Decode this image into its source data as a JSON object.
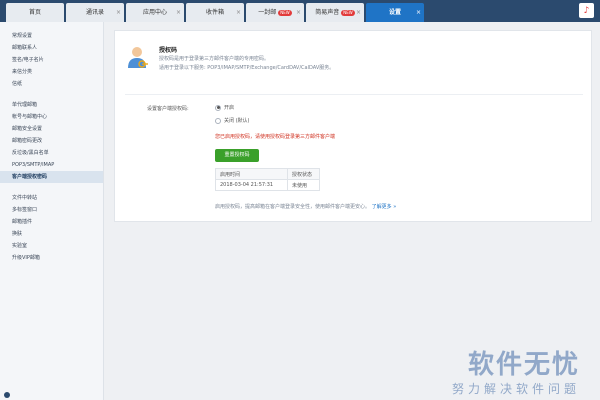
{
  "nav": {
    "tabs": [
      {
        "label": "首页",
        "active": false,
        "badge": ""
      },
      {
        "label": "通讯录",
        "active": false,
        "badge": ""
      },
      {
        "label": "应用中心",
        "active": false,
        "badge": ""
      },
      {
        "label": "收件箱",
        "active": false,
        "badge": ""
      },
      {
        "label": "一封邮",
        "active": false,
        "badge": "NEW"
      },
      {
        "label": "简易声音",
        "active": false,
        "badge": "NEW"
      },
      {
        "label": "设置",
        "active": true,
        "badge": ""
      }
    ],
    "close_glyph": "×",
    "user_icon": "app-icon"
  },
  "sidebar": {
    "groups": [
      {
        "items": [
          {
            "label": "常规设置"
          },
          {
            "label": "邮箱联系人"
          },
          {
            "label": "签名/电子名片"
          },
          {
            "label": "来信分类"
          },
          {
            "label": "信纸"
          }
        ]
      },
      {
        "items": [
          {
            "label": "单代理邮箱"
          },
          {
            "label": "帐号与邮箱中心"
          },
          {
            "label": "邮箱安全设置"
          },
          {
            "label": "邮箱密码更改"
          },
          {
            "label": "反垃圾/黑白名单"
          },
          {
            "label": "POP3/SMTP/IMAP"
          },
          {
            "label": "客户端授权密码",
            "active": true
          }
        ]
      },
      {
        "items": [
          {
            "label": "文件中转站"
          },
          {
            "label": "多标签窗口"
          },
          {
            "label": "邮箱插件"
          },
          {
            "label": "换肤"
          },
          {
            "label": "实验室"
          },
          {
            "label": "升级VIP邮箱"
          }
        ]
      }
    ]
  },
  "main": {
    "title": "授权码",
    "desc1": "授权码是用于登录第三方邮件客户端的专用密码。",
    "desc2": "适用于登录以下服务: POP3/IMAP/SMTP/Exchange/CardDAV/CalDAV服务。",
    "field_label": "设置客户端授权码:",
    "option_on": "开启",
    "option_off": "关闭 (默认)",
    "warning": "您已启用授权码，请使用授权码登录第三方邮件客户端",
    "button_label": "重置授权码",
    "table": {
      "headers": [
        "启用时间",
        "授权状态"
      ],
      "rows": [
        [
          "2018-03-04 21:57:31",
          "未使用"
        ]
      ]
    },
    "footer_note": "启用授权码，提高邮箱在客户端登录安全性，使用邮件客户端更安心。",
    "footer_link": "了解更多 »"
  },
  "watermark": {
    "title": "软件无忧",
    "subtitle": "努力解决软件问题"
  },
  "colors": {
    "nav_bg": "#2b4a6e",
    "active_tab": "#1f74c6",
    "button": "#3aa02a",
    "warning": "#d0301f",
    "link": "#1f74c6"
  }
}
